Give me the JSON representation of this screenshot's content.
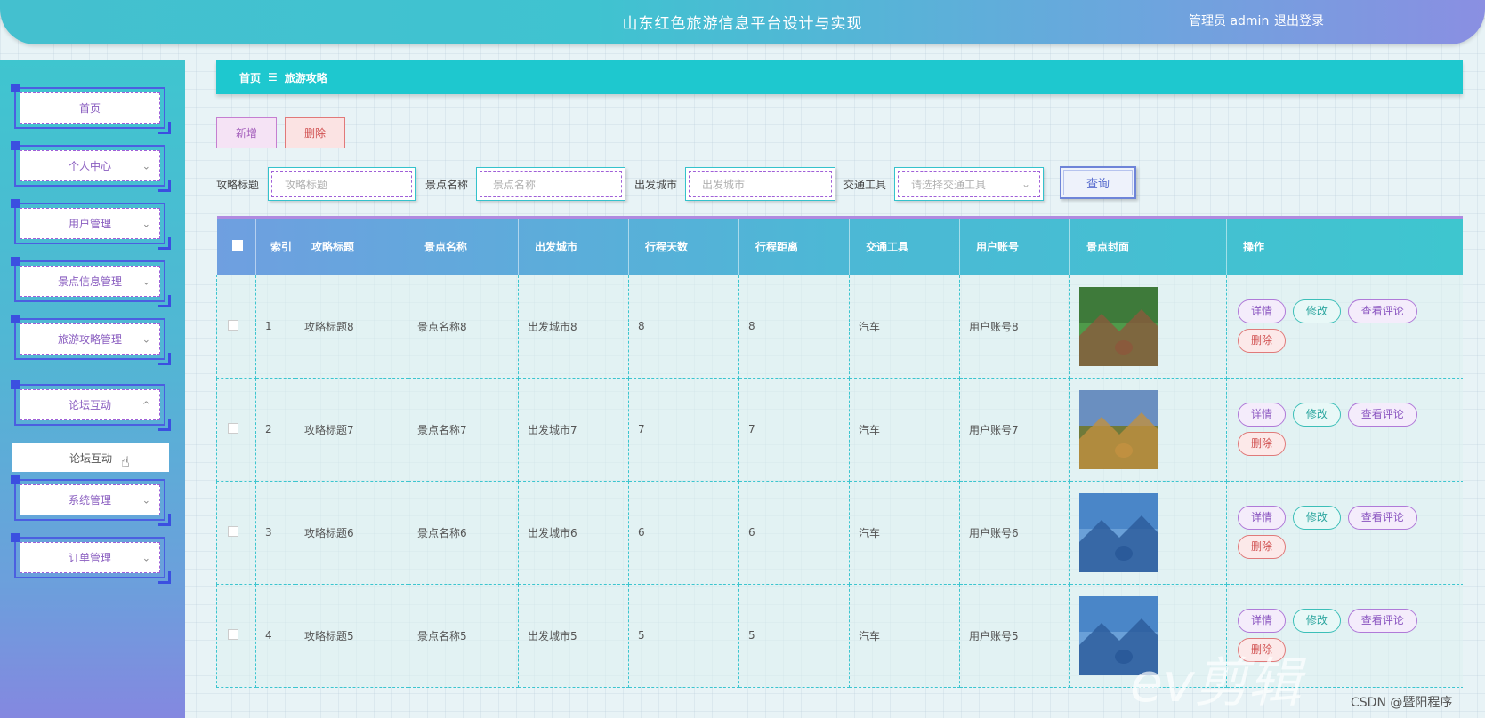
{
  "header": {
    "title": "山东红色旅游信息平台设计与实现",
    "user": "管理员 admin",
    "logout": "退出登录"
  },
  "sidebar": {
    "items": [
      {
        "label": "首页",
        "chevron": ""
      },
      {
        "label": "个人中心",
        "chevron": "⌄"
      },
      {
        "label": "用户管理",
        "chevron": "⌄"
      },
      {
        "label": "景点信息管理",
        "chevron": "⌄"
      },
      {
        "label": "旅游攻略管理",
        "chevron": "⌄"
      },
      {
        "label": "论坛互动",
        "chevron": "^"
      },
      {
        "label": "系统管理",
        "chevron": "⌄"
      },
      {
        "label": "订单管理",
        "chevron": "⌄"
      }
    ],
    "submenu": "论坛互动"
  },
  "breadcrumb": {
    "home": "首页",
    "sep": "☰",
    "current": "旅游攻略"
  },
  "toolbar": {
    "add": "新增",
    "delete": "删除"
  },
  "filters": {
    "title_label": "攻略标题",
    "title_placeholder": "攻略标题",
    "spot_label": "景点名称",
    "spot_placeholder": "景点名称",
    "city_label": "出发城市",
    "city_placeholder": "出发城市",
    "transport_label": "交通工具",
    "transport_placeholder": "请选择交通工具",
    "query": "查询"
  },
  "table": {
    "headers": [
      "",
      "索引",
      "攻略标题",
      "景点名称",
      "出发城市",
      "行程天数",
      "行程距离",
      "交通工具",
      "用户账号",
      "景点封面",
      "操作"
    ],
    "rows": [
      {
        "index": "1",
        "title": "攻略标题8",
        "spot": "景点名称8",
        "city": "出发城市8",
        "days": "8",
        "distance": "8",
        "transport": "汽车",
        "account": "用户账号8"
      },
      {
        "index": "2",
        "title": "攻略标题7",
        "spot": "景点名称7",
        "city": "出发城市7",
        "days": "7",
        "distance": "7",
        "transport": "汽车",
        "account": "用户账号7"
      },
      {
        "index": "3",
        "title": "攻略标题6",
        "spot": "景点名称6",
        "city": "出发城市6",
        "days": "6",
        "distance": "6",
        "transport": "汽车",
        "account": "用户账号6"
      },
      {
        "index": "4",
        "title": "攻略标题5",
        "spot": "景点名称5",
        "city": "出发城市5",
        "days": "5",
        "distance": "5",
        "transport": "汽车",
        "account": "用户账号5"
      }
    ],
    "ops": {
      "detail": "详情",
      "edit": "修改",
      "comment": "查看评论",
      "delete": "删除"
    }
  },
  "watermark": "ev剪辑",
  "credit": "CSDN @暨阳程序"
}
